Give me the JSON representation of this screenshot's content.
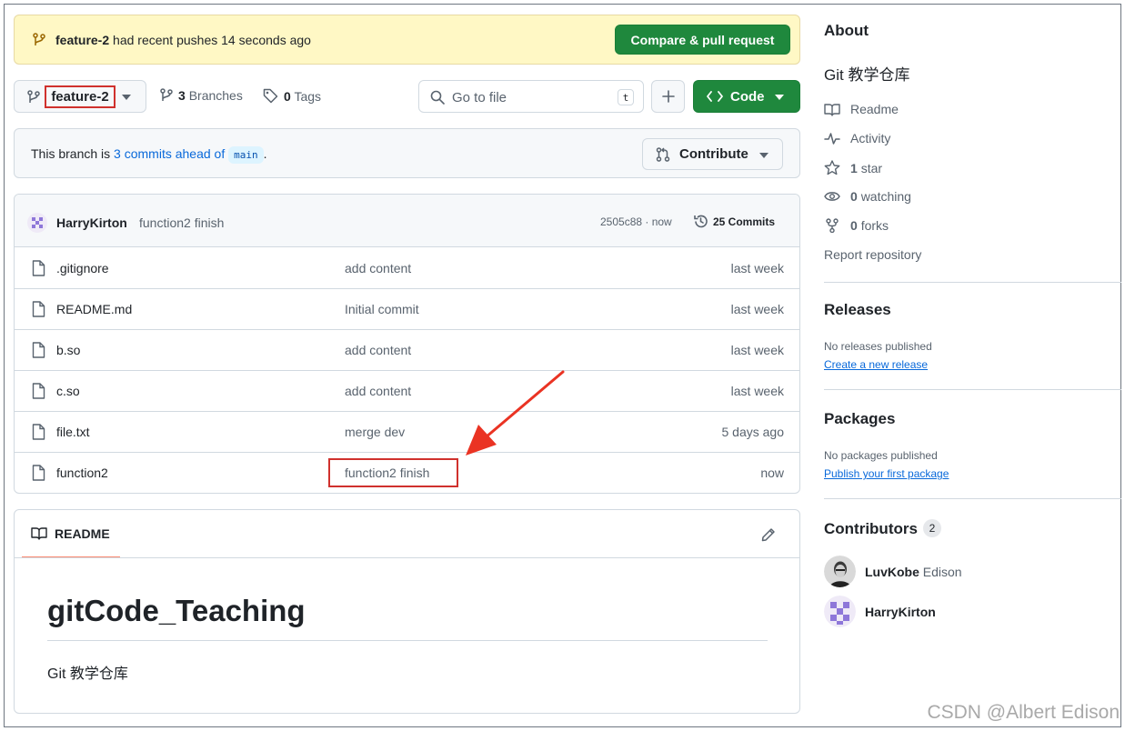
{
  "banner": {
    "branch": "feature-2",
    "message": "had recent pushes 14 seconds ago",
    "button_label": "Compare & pull request"
  },
  "toolbar": {
    "branch": "feature-2",
    "branches_count": "3",
    "branches_label": "Branches",
    "tags_count": "0",
    "tags_label": "Tags",
    "search_placeholder": "Go to file",
    "search_shortcut": "t",
    "code_label": "Code"
  },
  "ahead": {
    "prefix": "This branch is",
    "link": "3 commits ahead of",
    "base": "main",
    "suffix": ".",
    "contribute_label": "Contribute"
  },
  "latest_commit": {
    "author": "HarryKirton",
    "message": "function2 finish",
    "sha_time": "2505c88 · now",
    "commits_label": "25 Commits"
  },
  "files": [
    {
      "name": ".gitignore",
      "message": "add content",
      "date": "last week"
    },
    {
      "name": "README.md",
      "message": "Initial commit",
      "date": "last week"
    },
    {
      "name": "b.so",
      "message": "add content",
      "date": "last week"
    },
    {
      "name": "c.so",
      "message": "add content",
      "date": "last week"
    },
    {
      "name": "file.txt",
      "message": "merge dev",
      "date": "5 days ago"
    },
    {
      "name": "function2",
      "message": "function2 finish",
      "date": "now"
    }
  ],
  "readme": {
    "tab_label": "README",
    "title": "gitCode_Teaching",
    "body": "Git 教学仓库"
  },
  "sidebar": {
    "about_heading": "About",
    "description": "Git 教学仓库",
    "readme_label": "Readme",
    "activity_label": "Activity",
    "stars_count": "1",
    "stars_label": "star",
    "watching_count": "0",
    "watching_label": "watching",
    "forks_count": "0",
    "forks_label": "forks",
    "report_label": "Report repository",
    "releases_heading": "Releases",
    "releases_empty": "No releases published",
    "releases_link": "Create a new release",
    "packages_heading": "Packages",
    "packages_empty": "No packages published",
    "packages_link": "Publish your first package",
    "contributors_heading": "Contributors",
    "contributors_count": "2",
    "contributors": [
      {
        "login": "LuvKobe",
        "name": "Edison"
      },
      {
        "login": "HarryKirton",
        "name": ""
      }
    ]
  },
  "watermark": "CSDN @Albert Edison",
  "colors": {
    "primary_green": "#1f883d",
    "banner_yellow": "#fff8c5",
    "link_blue": "#0969da",
    "annotation_red": "#d0312d"
  }
}
